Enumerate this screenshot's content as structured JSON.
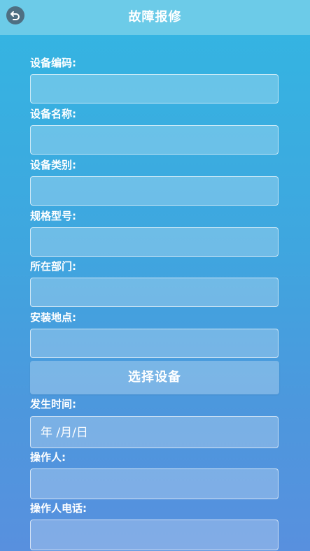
{
  "header": {
    "title": "故障报修",
    "back_icon": "back-arrow-icon"
  },
  "form": {
    "fields": [
      {
        "label": "设备编码:",
        "value": ""
      },
      {
        "label": "设备名称:",
        "value": ""
      },
      {
        "label": "设备类别:",
        "value": ""
      },
      {
        "label": "规格型号:",
        "value": ""
      },
      {
        "label": "所在部门:",
        "value": ""
      },
      {
        "label": "安装地点:",
        "value": ""
      }
    ],
    "select_button": "选择设备",
    "occurrence_time": {
      "label": "发生时间:",
      "placeholder": "年 /月/日"
    },
    "operator": {
      "label": "操作人:",
      "value": ""
    },
    "operator_phone": {
      "label": "操作人电话:",
      "value": ""
    }
  },
  "colors": {
    "header_bg": "#6ccbe8",
    "page_top": "#33b6e2",
    "page_bottom": "#5890de"
  }
}
